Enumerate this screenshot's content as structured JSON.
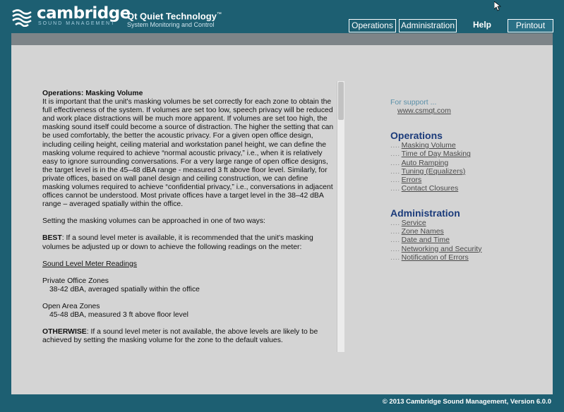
{
  "brand": {
    "word": "cambridge",
    "sub": "SOUND MANAGEMENT",
    "tagline_title": "Qt Quiet Technology",
    "tagline_tm": "™",
    "tagline_sub": "System Monitoring and Control"
  },
  "nav": {
    "tabs": [
      {
        "label": "Operations"
      },
      {
        "label": "Administration"
      },
      {
        "label": "Help"
      },
      {
        "label": "Printout"
      }
    ]
  },
  "article": {
    "title": "Operations: Masking Volume",
    "p1": "It is important that the unit's masking volumes be set correctly for each zone to obtain the full effectiveness of the system. If volumes are set too low, speech privacy will be reduced and work place distractions will be much more apparent. If volumes are set too high, the masking sound itself could become a source of distraction. The higher the setting that can be used comfortably, the better the acoustic privacy. For a given open office design, including ceiling height, ceiling material and workstation panel height, we can define the masking volume required to achieve “normal acoustic privacy,” i.e., when it is relatively easy to ignore surrounding conversations. For a very large range of open office designs, the target level is in the 45–48 dBA range - measured 3 ft above floor level. Similarly, for private offices, based on wall panel design and ceiling construction, we can define masking volumes required to achieve “confidential privacy,” i.e., conversations in adjacent offices cannot be understood. Most private offices have a target level in the 38–42 dBA range – averaged spatially within the office.",
    "p2": "Setting the masking volumes can be approached in one of two ways:",
    "best_label": "BEST",
    "best_text": ": If a sound level meter is available, it is recommended that the unit's masking volumes be adjusted up or down to achieve the following readings on the meter:",
    "readings_heading": "Sound Level Meter Readings",
    "private_heading": "Private Office Zones",
    "private_value": "38-42 dBA, averaged spatially within the office",
    "open_heading": "Open Area Zones",
    "open_value": "45-48 dBA, measured 3 ft above floor level",
    "otherwise_label": "OTHERWISE",
    "otherwise_text": ": If a sound level meter is not available, the above levels are likely to be achieved by setting the masking volume for the zone to the default values."
  },
  "support": {
    "label": "For support ...",
    "link": "www.csmqt.com"
  },
  "operations": {
    "title": "Operations",
    "items": [
      {
        "dots": "....",
        "label": "Masking Volume"
      },
      {
        "dots": "....",
        "label": "Time of Day Masking"
      },
      {
        "dots": "....",
        "label": "Auto Ramping"
      },
      {
        "dots": "....",
        "label": "Tuning (Equalizers)"
      },
      {
        "dots": "....",
        "label": "Errors"
      },
      {
        "dots": "....",
        "label": "Contact Closures"
      }
    ]
  },
  "administration": {
    "title": "Administration",
    "items": [
      {
        "dots": "....",
        "label": "Service"
      },
      {
        "dots": "....",
        "label": "Zone Names"
      },
      {
        "dots": "....",
        "label": "Date and Time"
      },
      {
        "dots": "....",
        "label": "Networking and Security"
      },
      {
        "dots": "....",
        "label": "Notification of Errors"
      }
    ]
  },
  "footer": {
    "text": "© 2013  Cambridge Sound Management,  Version 6.0.0"
  },
  "colors": {
    "frame": "#1d5f72",
    "gray_bar": "#7d8488",
    "content_bg": "#d4d4d4",
    "section_title": "#1a3a7a",
    "support_label": "#5a8fa8"
  }
}
